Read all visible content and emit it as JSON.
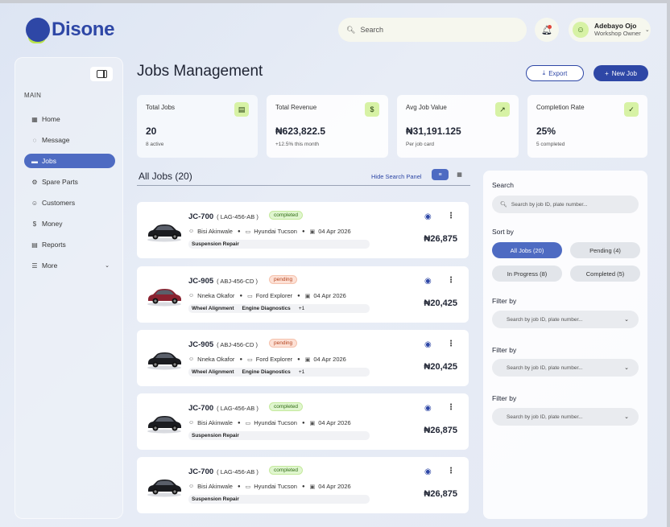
{
  "brand": {
    "name": "Disone"
  },
  "header": {
    "search_placeholder": "Search",
    "user": {
      "name": "Adebayo Ojo",
      "role": "Workshop Owner"
    }
  },
  "sidebar": {
    "section_label": "MAIN",
    "items": [
      {
        "label": "Home",
        "icon": "grid-icon"
      },
      {
        "label": "Message",
        "icon": "message-icon"
      },
      {
        "label": "Jobs",
        "icon": "car-icon",
        "active": true
      },
      {
        "label": "Spare Parts",
        "icon": "parts-icon"
      },
      {
        "label": "Customers",
        "icon": "users-icon"
      },
      {
        "label": "Money",
        "icon": "dollar-icon"
      },
      {
        "label": "Reports",
        "icon": "report-icon"
      },
      {
        "label": "More",
        "icon": "menu-icon"
      }
    ]
  },
  "page": {
    "title": "Jobs Management",
    "export_label": "Export",
    "new_job_label": "New Job"
  },
  "stats": [
    {
      "label": "Total Jobs",
      "value": "20",
      "sub": "8 active",
      "icon": "document-icon"
    },
    {
      "label": "Total Revenue",
      "value": "₦623,822.5",
      "sub": "+12.5% this month",
      "icon": "dollar-icon"
    },
    {
      "label": "Avg Job Value",
      "value": "₦31,191.125",
      "sub": "Per job card",
      "icon": "trend-up-icon"
    },
    {
      "label": "Completion Rate",
      "value": "25%",
      "sub": "5 completed",
      "icon": "check-circle-icon"
    }
  ],
  "list": {
    "heading": "All Jobs (20)",
    "hide_panel_label": "Hide Search Panel"
  },
  "jobs": [
    {
      "code": "JC-700",
      "plate": "( LAG-456-AB )",
      "status": "completed",
      "customer": "Bisi Akinwale",
      "vehicle": "Hyundai Tucson",
      "date": "04 Apr 2026",
      "tags": [
        "Suspension Repair"
      ],
      "more": "",
      "price": "₦26,875",
      "car_color": "#1b1c20"
    },
    {
      "code": "JC-905",
      "plate": "( ABJ-456-CD )",
      "status": "pending",
      "customer": "Nneka Okafor",
      "vehicle": "Ford Explorer",
      "date": "04 Apr 2026",
      "tags": [
        "Wheel Alignment",
        "Engine Diagnostics"
      ],
      "more": "+1",
      "price": "₦20,425",
      "car_color": "#8a2230"
    },
    {
      "code": "JC-905",
      "plate": "( ABJ-456-CD )",
      "status": "pending",
      "customer": "Nneka Okafor",
      "vehicle": "Ford Explorer",
      "date": "04 Apr 2026",
      "tags": [
        "Wheel Alignment",
        "Engine Diagnostics"
      ],
      "more": "+1",
      "price": "₦20,425",
      "car_color": "#1b1c20"
    },
    {
      "code": "JC-700",
      "plate": "( LAG-456-AB )",
      "status": "completed",
      "customer": "Bisi Akinwale",
      "vehicle": "Hyundai Tucson",
      "date": "04 Apr 2026",
      "tags": [
        "Suspension Repair"
      ],
      "more": "",
      "price": "₦26,875",
      "car_color": "#1b1c20"
    },
    {
      "code": "JC-700",
      "plate": "( LAG-456-AB )",
      "status": "completed",
      "customer": "Bisi Akinwale",
      "vehicle": "Hyundai Tucson",
      "date": "04 Apr 2026",
      "tags": [
        "Suspension Repair"
      ],
      "more": "",
      "price": "₦26,875",
      "car_color": "#1b1c20"
    }
  ],
  "panel": {
    "search_label": "Search",
    "search_placeholder": "Search by job ID, plate number...",
    "sort_label": "Sort by",
    "sort_options": [
      "All Jobs (20)",
      "Pending (4)",
      "In Progress (8)",
      "Completed (5)"
    ],
    "filters": [
      {
        "label": "Filter by",
        "placeholder": "Search by job ID, plate number..."
      },
      {
        "label": "Filter by",
        "placeholder": "Search by job ID, plate number..."
      },
      {
        "label": "Filter by",
        "placeholder": "Search by job ID, plate number..."
      }
    ]
  },
  "colors": {
    "primary": "#2e47a6",
    "accent": "#b9e34a",
    "active_nav": "#4e6bc2"
  }
}
